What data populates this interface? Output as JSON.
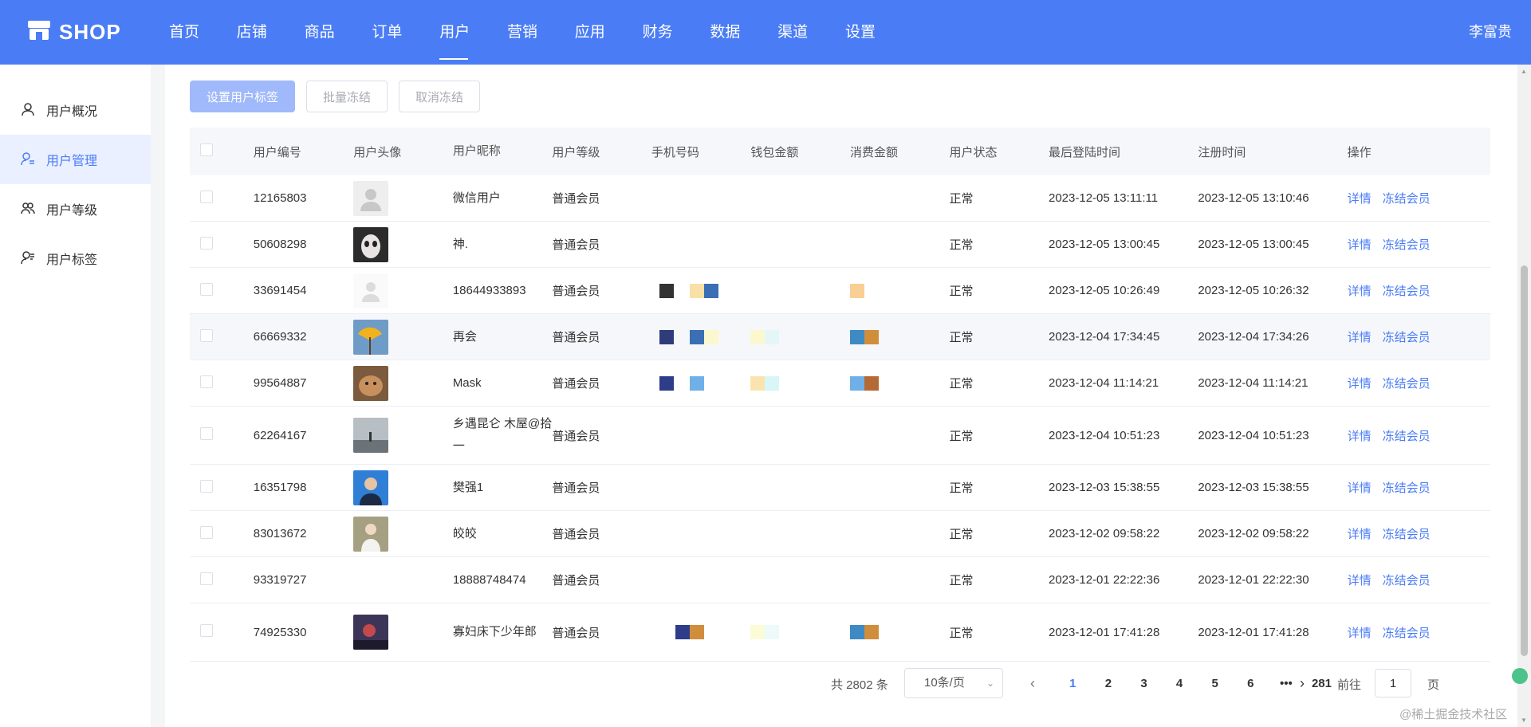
{
  "header": {
    "logo_text": "SHOP",
    "nav": [
      "首页",
      "店铺",
      "商品",
      "订单",
      "用户",
      "营销",
      "应用",
      "财务",
      "数据",
      "渠道",
      "设置"
    ],
    "active_nav": "用户",
    "user_name": "李富贵"
  },
  "sidebar": {
    "items": [
      {
        "label": "用户概况",
        "icon": "user-icon"
      },
      {
        "label": "用户管理",
        "icon": "user-list-icon"
      },
      {
        "label": "用户等级",
        "icon": "users-group-icon"
      },
      {
        "label": "用户标签",
        "icon": "user-tag-icon"
      }
    ],
    "active": "用户管理"
  },
  "toolbar": {
    "set_tag_label": "设置用户标签",
    "batch_freeze_label": "批量冻结",
    "unfreeze_label": "取消冻结"
  },
  "table": {
    "headers": {
      "id": "用户编号",
      "avatar": "用户头像",
      "nickname": "用户昵称",
      "level": "用户等级",
      "phone": "手机号码",
      "wallet": "钱包金额",
      "spend": "消费金额",
      "status": "用户状态",
      "last_login": "最后登陆时间",
      "register": "注册时间",
      "ops": "操作"
    },
    "rows": [
      {
        "id": "12165803",
        "nickname": "微信用户",
        "level": "普通会员",
        "status": "正常",
        "last_login": "2023-12-05 13:11:11",
        "register": "2023-12-05 13:10:46",
        "detail": "详情",
        "freeze": "冻结会员"
      },
      {
        "id": "50608298",
        "nickname": "神.",
        "level": "普通会员",
        "status": "正常",
        "last_login": "2023-12-05 13:00:45",
        "register": "2023-12-05 13:00:45",
        "detail": "详情",
        "freeze": "冻结会员"
      },
      {
        "id": "33691454",
        "nickname": "18644933893",
        "level": "普通会员",
        "status": "正常",
        "last_login": "2023-12-05 10:26:49",
        "register": "2023-12-05 10:26:32",
        "detail": "详情",
        "freeze": "冻结会员"
      },
      {
        "id": "66669332",
        "nickname": "再会",
        "level": "普通会员",
        "status": "正常",
        "last_login": "2023-12-04 17:34:45",
        "register": "2023-12-04 17:34:26",
        "detail": "详情",
        "freeze": "冻结会员"
      },
      {
        "id": "99564887",
        "nickname": "Mask",
        "level": "普通会员",
        "status": "正常",
        "last_login": "2023-12-04 11:14:21",
        "register": "2023-12-04 11:14:21",
        "detail": "详情",
        "freeze": "冻结会员"
      },
      {
        "id": "62264167",
        "nickname": "乡遇昆仑 木屋@拾一",
        "level": "普通会员",
        "status": "正常",
        "last_login": "2023-12-04 10:51:23",
        "register": "2023-12-04 10:51:23",
        "detail": "详情",
        "freeze": "冻结会员"
      },
      {
        "id": "16351798",
        "nickname": "樊强1",
        "level": "普通会员",
        "status": "正常",
        "last_login": "2023-12-03 15:38:55",
        "register": "2023-12-03 15:38:55",
        "detail": "详情",
        "freeze": "冻结会员"
      },
      {
        "id": "83013672",
        "nickname": "皎皎",
        "level": "普通会员",
        "status": "正常",
        "last_login": "2023-12-02 09:58:22",
        "register": "2023-12-02 09:58:22",
        "detail": "详情",
        "freeze": "冻结会员"
      },
      {
        "id": "93319727",
        "nickname": "18888748474",
        "level": "普通会员",
        "status": "正常",
        "last_login": "2023-12-01 22:22:36",
        "register": "2023-12-01 22:22:30",
        "detail": "详情",
        "freeze": "冻结会员"
      },
      {
        "id": "74925330",
        "nickname": "寡妇床下少年郎",
        "level": "普通会员",
        "status": "正常",
        "last_login": "2023-12-01 17:41:28",
        "register": "2023-12-01 17:41:28",
        "detail": "详情",
        "freeze": "冻结会员"
      }
    ]
  },
  "pagination": {
    "total": "共 2802 条",
    "page_size": "10条/页",
    "pages": [
      "1",
      "2",
      "3",
      "4",
      "5",
      "6",
      "•••",
      "281"
    ],
    "current": "1",
    "goto_label": "前往",
    "goto_value": "1",
    "goto_unit": "页"
  },
  "watermark": "@稀土掘金技术社区",
  "colors": {
    "brand": "#4a7cf6",
    "primary_disabled": "#a0b9fa",
    "active_bg": "#eaf0ff"
  }
}
